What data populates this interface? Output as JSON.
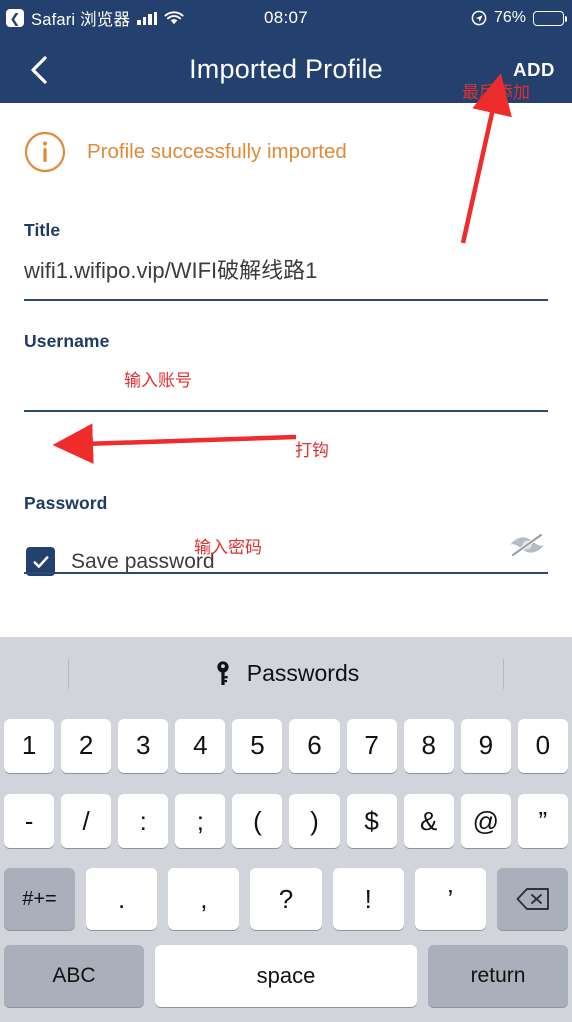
{
  "status_bar": {
    "back_badge": "❮",
    "carrier_app": "Safari 浏览器",
    "signal_icon": "signal-bars-icon",
    "wifi_icon": "wifi-icon",
    "time": "08:07",
    "location_icon": "location-arrow-icon",
    "battery_percent": "76%",
    "battery_icon": "battery-icon",
    "background_color": "#23406e"
  },
  "nav_bar": {
    "back_icon": "chevron-left-icon",
    "title": "Imported Profile",
    "add_label": "ADD",
    "background_color": "#23406e"
  },
  "banner": {
    "icon": "info-circle-icon",
    "text": "Profile successfully imported",
    "color": "#e08a38"
  },
  "form": {
    "title_field": {
      "label": "Title",
      "value": "wifi1.wifipo.vip/WIFI破解线路1",
      "placeholder": "Title"
    },
    "username_field": {
      "label": "Username",
      "value": "",
      "placeholder": "Username"
    },
    "save_password": {
      "label": "Save password",
      "checked": true,
      "check_icon": "checkmark-icon"
    },
    "password_field": {
      "label": "Password",
      "value": "",
      "placeholder": "Password",
      "visibility_icon": "eye-off-icon"
    }
  },
  "annotations": [
    {
      "text": "最后添加",
      "color": "#e03030",
      "target": "add-button"
    },
    {
      "text": "输入账号",
      "color": "#e03030",
      "target": "username-input"
    },
    {
      "text": "打钩",
      "color": "#e03030",
      "target": "save-password-checkbox"
    },
    {
      "text": "输入密码",
      "color": "#e03030",
      "target": "password-input"
    }
  ],
  "keyboard": {
    "toolbar": {
      "icon": "key-icon",
      "label": "Passwords"
    },
    "row1": [
      "1",
      "2",
      "3",
      "4",
      "5",
      "6",
      "7",
      "8",
      "9",
      "0"
    ],
    "row2": [
      "-",
      "/",
      ":",
      ";",
      "(",
      ")",
      "$",
      "&",
      "@",
      "”"
    ],
    "row3": {
      "modifier": "#+=",
      "keys": [
        ".",
        ",",
        "?",
        "!",
        "’"
      ],
      "backspace_icon": "backspace-icon"
    },
    "row4": {
      "abc": "ABC",
      "space": "space",
      "return": "return"
    },
    "background_color": "#d1d4da"
  }
}
